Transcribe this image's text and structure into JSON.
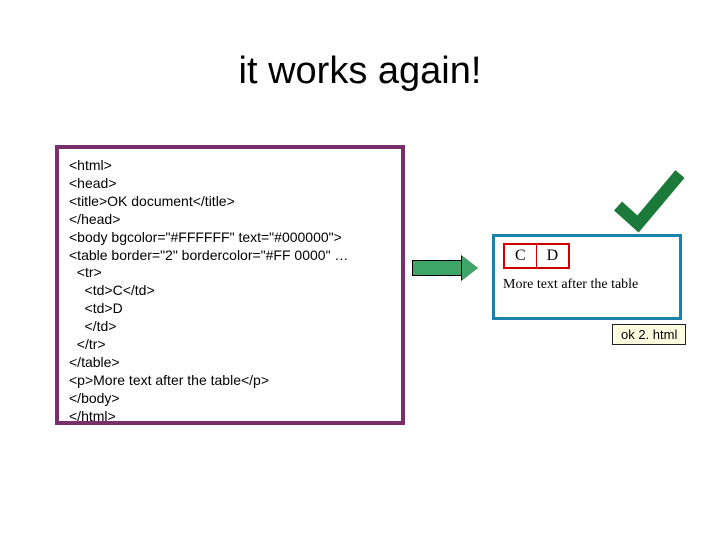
{
  "title": "it works again!",
  "code": "<html>\n<head>\n<title>OK document</title>\n</head>\n<body bgcolor=\"#FFFFFF\" text=\"#000000\">\n<table border=\"2\" bordercolor=\"#FF 0000\" …\n  <tr>\n    <td>C</td>\n    <td>D\n    </td>\n  </tr>\n</table>\n<p>More text after the table</p>\n</body>\n</html>",
  "rendered": {
    "cell_left": "C",
    "cell_right": "D",
    "paragraph": "More text after the table"
  },
  "filename": "ok 2. html",
  "check_color": "#1b7a3a"
}
